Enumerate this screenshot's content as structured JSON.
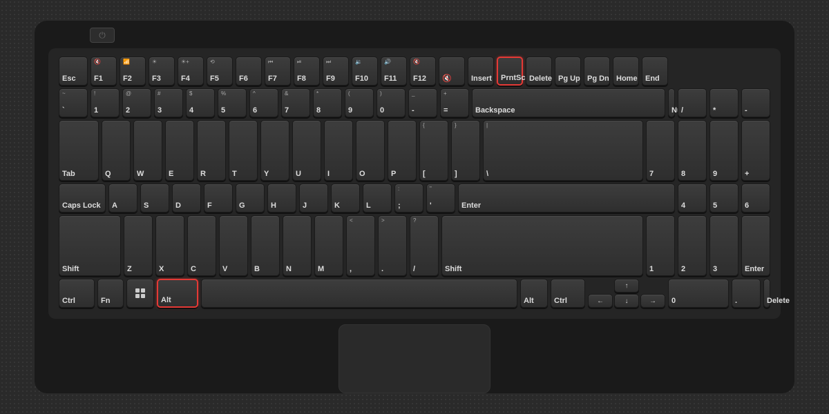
{
  "keyboard": {
    "highlighted_keys": [
      "PrntScr",
      "Alt"
    ],
    "rows": {
      "fn_row": [
        "Esc",
        "F1",
        "F2",
        "F3",
        "F4",
        "F5",
        "F6",
        "F7",
        "F8",
        "F9",
        "F10",
        "F11",
        "F12",
        "Mute",
        "Insert",
        "PrntScr",
        "Delete",
        "PgUp",
        "PgDn",
        "Home",
        "End"
      ],
      "number_row": [
        "~\n`",
        "!\n1",
        "@\n2",
        "#\n3",
        "$\n4",
        "%\n5",
        "^\n6",
        "&\n7",
        "*\n8",
        "(\n9",
        ")\n0",
        "_\n-",
        "+\n=",
        "Backspace"
      ],
      "qwerty_row": [
        "Tab",
        "Q",
        "W",
        "E",
        "R",
        "T",
        "Y",
        "U",
        "I",
        "O",
        "P",
        "{\n[",
        "}\n]",
        "|\n\\"
      ],
      "home_row": [
        "Caps Lock",
        "A",
        "S",
        "D",
        "F",
        "G",
        "H",
        "J",
        "K",
        "L",
        ":\n;",
        "\"\n'",
        "Enter"
      ],
      "shift_row": [
        "Shift",
        "Z",
        "X",
        "C",
        "V",
        "B",
        "N",
        "M",
        "<\n,",
        ">\n.",
        "?\n/",
        "Shift"
      ],
      "bottom_row": [
        "Ctrl",
        "Fn",
        "Win",
        "Alt",
        "Space",
        "Alt",
        "Ctrl"
      ]
    }
  },
  "keys": {
    "esc": "Esc",
    "f1": "F1",
    "f1_fn": "🔇",
    "f2": "F2",
    "f3": "F3",
    "f4": "F4",
    "f5": "F5",
    "f6": "F6",
    "f7": "F7",
    "f8": "F8",
    "f9": "F9",
    "f10": "F10",
    "f11": "F11",
    "f12": "F12",
    "insert": "Insert",
    "prtscr": "PrntScr",
    "delete": "Delete",
    "pgup": "Pg Up",
    "pgdn": "Pg Dn",
    "home": "Home",
    "end": "End",
    "backspace": "Backspace",
    "numlock": "NumLk",
    "tab": "Tab",
    "caps": "Caps Lock",
    "enter": "Enter",
    "shift_left": "Shift",
    "shift_right": "Shift",
    "ctrl": "Ctrl",
    "fn": "Fn",
    "alt_left": "Alt",
    "alt_right": "Alt",
    "ctrl_right": "Ctrl",
    "space": ""
  }
}
